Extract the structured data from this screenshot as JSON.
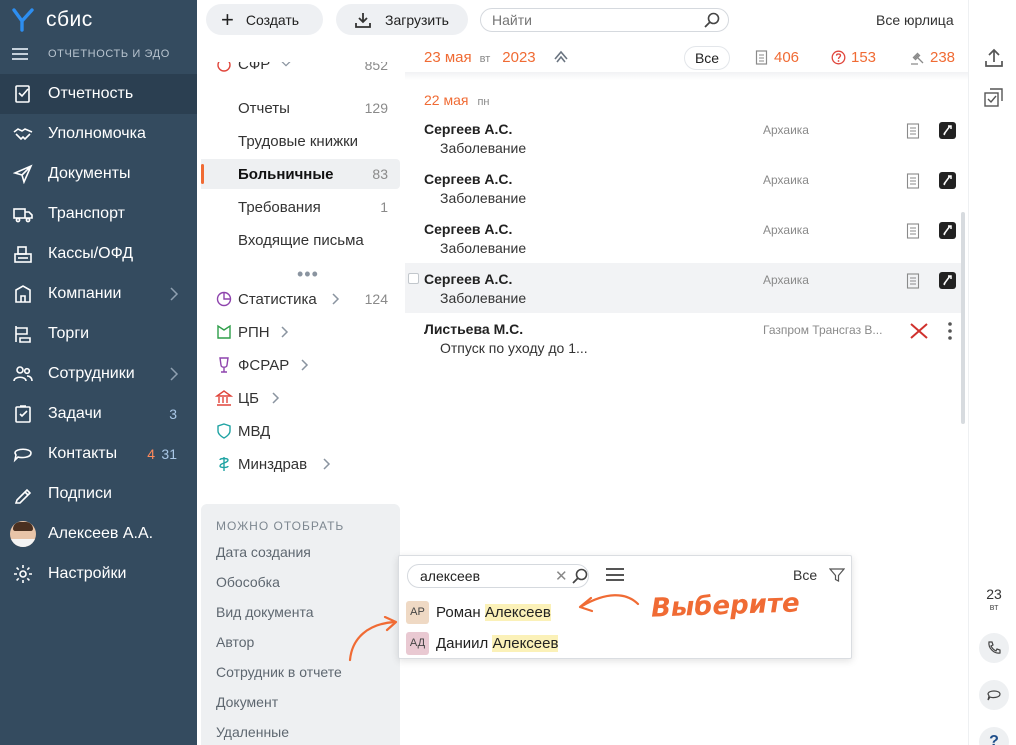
{
  "app": {
    "logo_text": "сбис",
    "section_title": "ОТЧЕТНОСТЬ И ЭДО"
  },
  "sidebar": {
    "items": [
      {
        "label": "Отчетность",
        "icon": "report-icon"
      },
      {
        "label": "Уполномочка",
        "icon": "handshake-icon"
      },
      {
        "label": "Документы",
        "icon": "send-icon"
      },
      {
        "label": "Транспорт",
        "icon": "truck-icon"
      },
      {
        "label": "Кассы/ОФД",
        "icon": "cashbox-icon"
      },
      {
        "label": "Компании",
        "icon": "company-icon"
      },
      {
        "label": "Торги",
        "icon": "gavel-icon"
      },
      {
        "label": "Сотрудники",
        "icon": "employees-icon"
      },
      {
        "label": "Задачи",
        "icon": "tasks-icon",
        "count": "3"
      },
      {
        "label": "Контакты",
        "icon": "chat-icon",
        "count_red": "4",
        "count": "31"
      },
      {
        "label": "Подписи",
        "icon": "signature-icon"
      },
      {
        "label": "Алексеев А.А.",
        "icon": "avatar"
      },
      {
        "label": "Настройки",
        "icon": "gear-icon"
      }
    ]
  },
  "toolbar": {
    "create_label": "Создать",
    "upload_label": "Загрузить",
    "search_placeholder": "Найти",
    "org_filter": "Все юрлица",
    "people_icon": "ОО"
  },
  "header": {
    "date_day": "23 мая",
    "date_dow": "вт",
    "date_year": "2023",
    "all_label": "Все",
    "stat_docs": "406",
    "stat_questions": "153",
    "stat_requests": "238"
  },
  "folders": {
    "top_partial": {
      "label": "СФР",
      "count": "852"
    },
    "items": [
      {
        "label": "Отчеты",
        "count": "129"
      },
      {
        "label": "Трудовые книжки",
        "count": ""
      },
      {
        "label": "Больничные",
        "count": "83"
      },
      {
        "label": "Требования",
        "count": "1"
      },
      {
        "label": "Входящие письма",
        "count": ""
      }
    ],
    "more": "•••",
    "groups": [
      {
        "label": "Статистика",
        "count": "124"
      },
      {
        "label": "РПН",
        "count": ""
      },
      {
        "label": "ФСРАР",
        "count": ""
      },
      {
        "label": "ЦБ",
        "count": ""
      },
      {
        "label": "МВД",
        "count": ""
      },
      {
        "label": "Минздрав",
        "count": ""
      }
    ]
  },
  "filters": {
    "title": "МОЖНО ОТОБРАТЬ",
    "items": [
      "Дата создания",
      "Обособка",
      "Вид документа",
      "Автор",
      "Сотрудник в отчете",
      "Документ",
      "Удаленные"
    ]
  },
  "list": {
    "day_label": "22 мая",
    "day_dow": "пн",
    "messages": [
      {
        "name": "Сергеев А.С.",
        "subject": "Заболевание",
        "org": "Архаика"
      },
      {
        "name": "Сергеев А.С.",
        "subject": "Заболевание",
        "org": "Архаика"
      },
      {
        "name": "Сергеев А.С.",
        "subject": "Заболевание",
        "org": "Архаика"
      },
      {
        "name": "Сергеев А.С.",
        "subject": "Заболевание",
        "org": "Архаика"
      },
      {
        "name": "Листьева М.С.",
        "subject": "Отпуск по уходу до 1...",
        "org": "Газпром Трансгаз В..."
      }
    ]
  },
  "rail": {
    "date_num": "23",
    "date_dow": "вт",
    "help": "?"
  },
  "popup": {
    "search_value": "алексеев",
    "all_label": "Все",
    "results": [
      {
        "initials": "АР",
        "first": "Роман",
        "last": "Алексеев",
        "color": "#efd9c4"
      },
      {
        "initials": "АД",
        "first": "Даниил",
        "last": "Алексеев",
        "color": "#e9c9d2"
      }
    ]
  },
  "annotation": {
    "hint": "Выберите"
  },
  "colors": {
    "sidebar_bg": "#344b5f",
    "accent": "#f06b34",
    "highlight": "#fbf1b8"
  }
}
